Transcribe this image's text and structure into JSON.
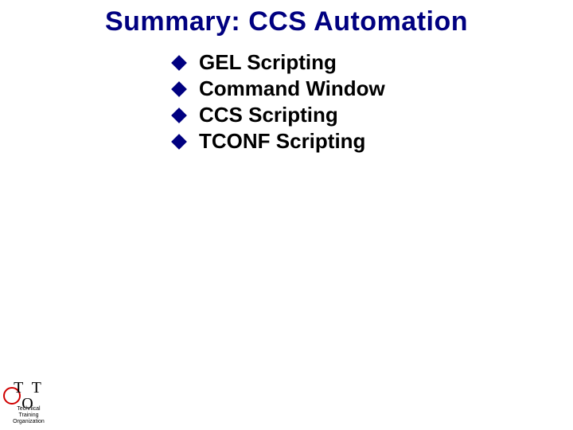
{
  "title": "Summary: CCS Automation",
  "bullets": {
    "items": [
      {
        "text": "GEL Scripting"
      },
      {
        "text": "Command Window"
      },
      {
        "text": "CCS Scripting"
      },
      {
        "text": "TCONF Scripting"
      }
    ]
  },
  "logo": {
    "acronym": "T T O",
    "line1": "Technical",
    "line2": "Training",
    "line3": "Organization"
  }
}
